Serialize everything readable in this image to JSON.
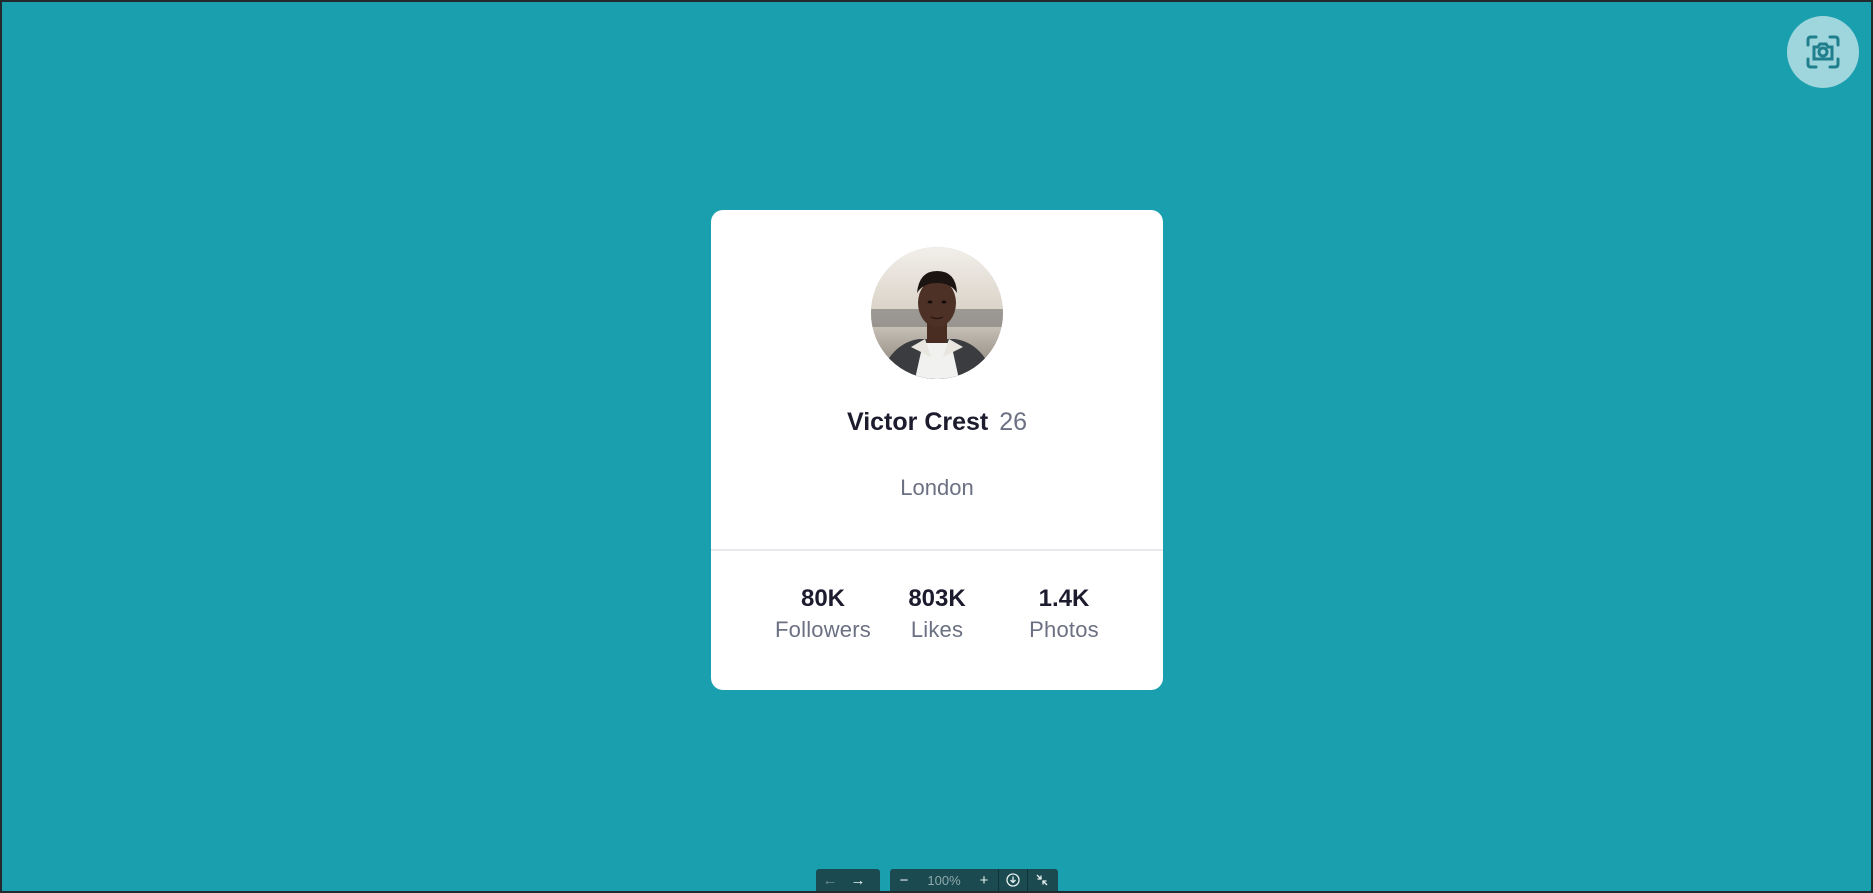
{
  "profile": {
    "name": "Victor Crest",
    "age": "26",
    "city": "London",
    "stats": [
      {
        "value": "80K",
        "label": "Followers"
      },
      {
        "value": "803K",
        "label": "Likes"
      },
      {
        "value": "1.4K",
        "label": "Photos"
      }
    ]
  },
  "toolbar": {
    "back_icon": "arrow-left-icon",
    "forward_icon": "arrow-right-icon",
    "zoom_out_icon": "minus-icon",
    "zoom_level": "100%",
    "zoom_in_icon": "plus-icon",
    "download_icon": "download-icon",
    "collapse_icon": "collapse-icon"
  },
  "capture_icon": "screenshot-capture-icon",
  "colors": {
    "background": "#1a9faf",
    "card": "#ffffff",
    "text_dark": "#1c1c2e",
    "text_muted": "#6b7082",
    "capture_button": "#9fd5dc",
    "toolbar": "#1b4a50"
  }
}
